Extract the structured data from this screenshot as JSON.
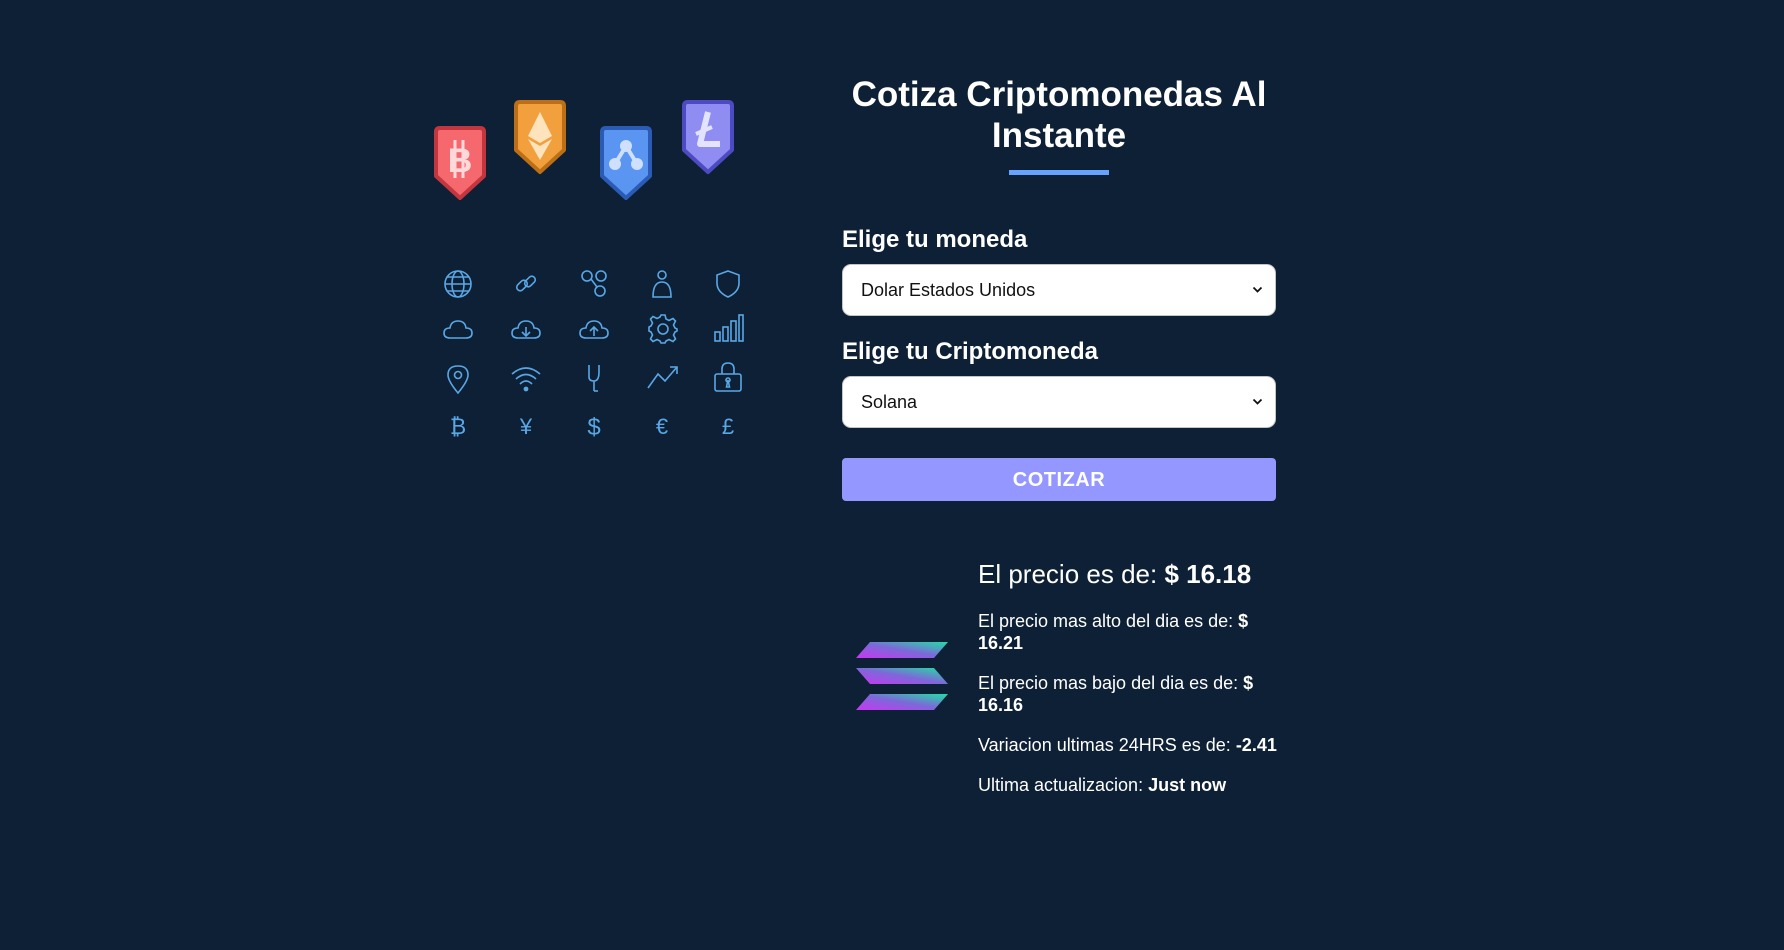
{
  "header": {
    "title": "Cotiza Criptomonedas Al Instante"
  },
  "form": {
    "currency_label": "Elige tu moneda",
    "currency_selected": "Dolar Estados Unidos",
    "crypto_label": "Elige tu Criptomoneda",
    "crypto_selected": "Solana",
    "submit_label": "COTIZAR"
  },
  "result": {
    "price_label": "El precio es de:",
    "price_value": "$ 16.18",
    "high_label": "El precio mas alto del dia es de:",
    "high_value": "$ 16.21",
    "low_label": "El precio mas bajo del dia es de:",
    "low_value": "$ 16.16",
    "change_label": "Variacion ultimas 24HRS es de:",
    "change_value": "-2.41",
    "updated_label": "Ultima actualizacion:",
    "updated_value": "Just now",
    "logo": "solana-logo"
  },
  "illustration": {
    "badges": [
      "bitcoin-badge",
      "ethereum-badge",
      "ripple-badge",
      "litecoin-badge"
    ],
    "icons": [
      "globe-icon",
      "link-icon",
      "network-icon",
      "user-icon",
      "shield-icon",
      "cloud-icon",
      "cloud-download-icon",
      "cloud-upload-icon",
      "gear-icon",
      "bar-chart-icon",
      "location-pin-icon",
      "wifi-icon",
      "fork-icon",
      "trend-up-icon",
      "padlock-icon",
      "bitcoin-symbol-icon",
      "yen-icon",
      "dollar-icon",
      "euro-icon",
      "pound-icon"
    ]
  },
  "colors": {
    "background": "#0d2035",
    "accent": "#66a2fe",
    "button": "#9497ff",
    "icon_stroke": "#5aa7e6",
    "bitcoin_badge": "#f4686e",
    "ethereum_badge": "#f2a03d",
    "ripple_badge": "#5b95f2",
    "litecoin_badge": "#8f8cf2"
  }
}
